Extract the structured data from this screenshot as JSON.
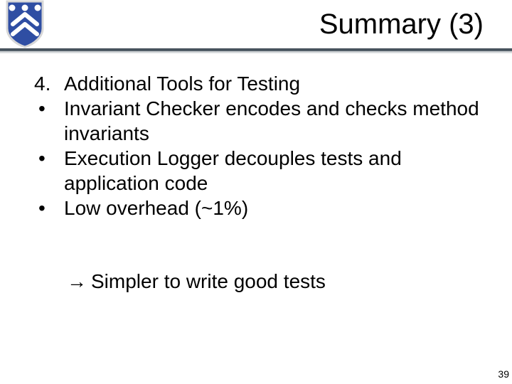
{
  "title": "Summary (3)",
  "heading_number": "4.",
  "heading_text": "Additional Tools for Testing",
  "bullets": [
    "Invariant Checker encodes and checks method invariants",
    "Execution Logger decouples tests and application code",
    "Low overhead (~1%)"
  ],
  "bullet_glyph": "•",
  "arrow_glyph": "à",
  "conclusion": "Simpler to write good tests",
  "page_number": "39",
  "logo_colors": {
    "shield": "#2f4ea3",
    "outline": "#d7d7d7",
    "chevron": "#ffffff"
  }
}
